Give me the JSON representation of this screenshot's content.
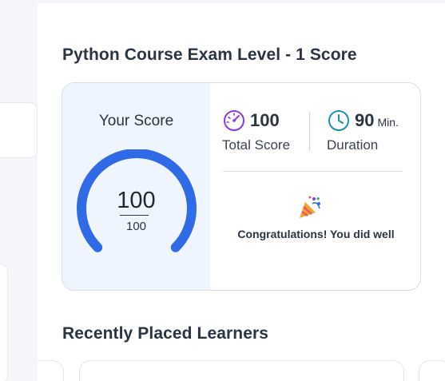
{
  "exam": {
    "title": "Python Course Exam Level - 1 Score"
  },
  "score_card": {
    "your_score_label": "Your Score",
    "score": "100",
    "max_score": "100",
    "score_fraction": 1.0,
    "accent_color": "#2f6be6",
    "total_score_value": "100",
    "total_score_label": "Total Score",
    "duration_value": "90",
    "duration_unit": "Min.",
    "duration_label": "Duration",
    "message": "Congratulations! You did well"
  },
  "learners": {
    "title": "Recently Placed Learners"
  },
  "icons": {
    "speedometer": "speedometer-icon",
    "clock": "clock-icon",
    "party": "party-popper-icon"
  }
}
